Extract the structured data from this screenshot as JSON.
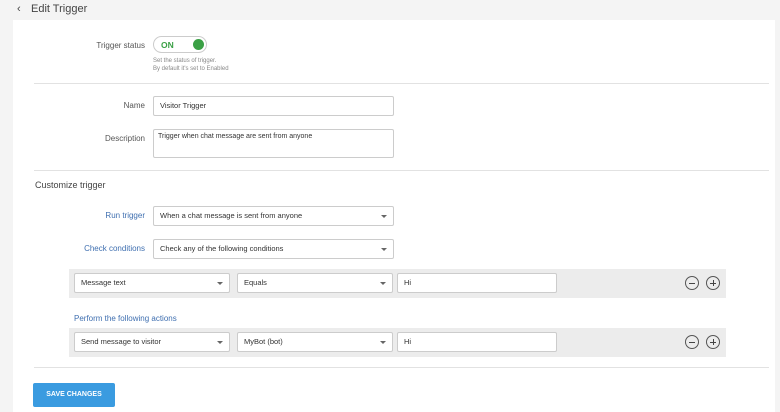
{
  "header": {
    "back_icon": "chevron-left",
    "title": "Edit Trigger"
  },
  "status": {
    "label": "Trigger status",
    "toggle_text": "ON",
    "toggle_on": true,
    "hint_line1": "Set the status of trigger.",
    "hint_line2": "By default it's set to Enabled"
  },
  "name": {
    "label": "Name",
    "value": "Visitor Trigger"
  },
  "description": {
    "label": "Description",
    "value": "Trigger when chat message are sent from anyone"
  },
  "customize": {
    "title": "Customize trigger",
    "run_trigger_label": "Run trigger",
    "run_trigger_value": "When a chat message is sent from anyone",
    "check_conditions_label": "Check conditions",
    "check_conditions_value": "Check any of the following conditions"
  },
  "condition": {
    "field": "Message text",
    "operator": "Equals",
    "value": "Hi"
  },
  "actions": {
    "title": "Perform the following actions",
    "action": "Send message to visitor",
    "bot": "MyBot (bot)",
    "value": "Hi"
  },
  "save_label": "SAVE CHANGES",
  "colors": {
    "accent": "#3a9be0",
    "toggle_on": "#3aa045",
    "link_blue": "#3f6fb0"
  }
}
